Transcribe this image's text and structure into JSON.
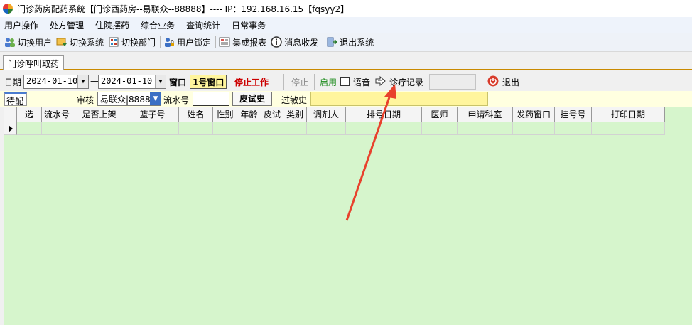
{
  "window": {
    "title": "门诊药房配药系统【门诊西药房--易联众--88888】---- IP：192.168.16.15【fqsyy2】"
  },
  "menu": [
    "用户操作",
    "处方管理",
    "住院摆药",
    "综合业务",
    "查询统计",
    "日常事务"
  ],
  "toolbar": {
    "switch_user": "切换用户",
    "switch_system": "切换系统",
    "switch_dept": "切换部门",
    "lock_user": "用户锁定",
    "report": "集成报表",
    "messages": "消息收发",
    "exit_system": "退出系统"
  },
  "tab": {
    "label": "门诊呼叫取药"
  },
  "filter": {
    "date_label": "日期",
    "date_from": "2024-01-10",
    "dash": "—",
    "date_to": "2024-01-10",
    "window_label": "窗口",
    "window_value": "1号窗口",
    "stop_work": "停止工作",
    "stop": "停止",
    "enable": "启用",
    "voice": "语音",
    "records": "诊疗记录",
    "exit": "退出"
  },
  "row2": {
    "pending": "待配",
    "review_label": "审核",
    "review_value": "易联众|8888",
    "serial_label": "流水号",
    "skin_test_button": "皮试史",
    "allergy_label": "过敏史"
  },
  "grid": {
    "columns": [
      "选",
      "流水号",
      "是否上架",
      "篮子号",
      "姓名",
      "性别",
      "年龄",
      "皮试",
      "类别",
      "调剂人",
      "排号日期",
      "医师",
      "申请科室",
      "发药窗口",
      "挂号号",
      "打印日期"
    ]
  },
  "colors": {
    "grid_bg": "#d6f5cc",
    "highlight": "#fff59d",
    "alert_red": "#cc0000",
    "tab_border": "#c98a00",
    "arrow": "#e8412c"
  }
}
